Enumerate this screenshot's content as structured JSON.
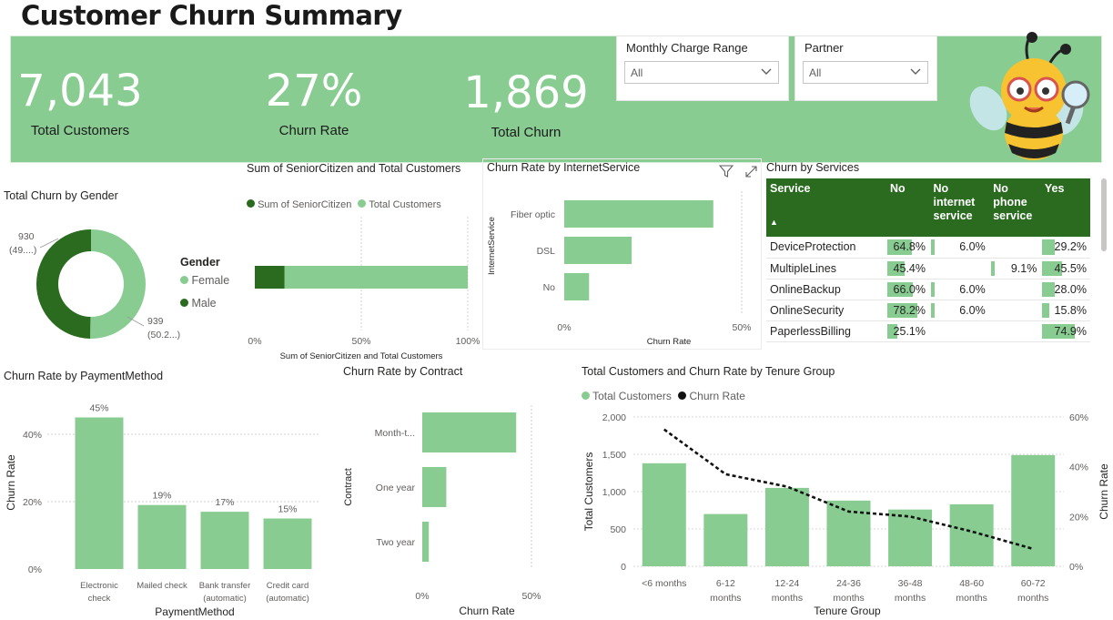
{
  "page": {
    "title": "Customer Churn Summary"
  },
  "kpis": [
    {
      "value": "7,043",
      "label": "Total Customers"
    },
    {
      "value": "27%",
      "label": "Churn Rate"
    },
    {
      "value": "1,869",
      "label": "Total Churn"
    }
  ],
  "slicers": {
    "monthly_charge": {
      "title": "Monthly Charge Range",
      "value": "All"
    },
    "partner": {
      "title": "Partner",
      "value": "All"
    }
  },
  "colors": {
    "light_green": "#88cc92",
    "dark_green": "#2a6b1f",
    "banner": "#88cc92"
  },
  "gender_chart": {
    "title": "Total Churn by Gender",
    "legend_title": "Gender",
    "legend": [
      "Female",
      "Male"
    ],
    "label_male": [
      "930",
      "(49....)"
    ],
    "label_female": [
      "939",
      "(50.2...)"
    ],
    "chart_data": {
      "type": "pie",
      "categories": [
        "Female",
        "Male"
      ],
      "values": [
        939,
        930
      ]
    }
  },
  "senior_chart": {
    "title": "Sum of SeniorCitizen and Total Customers",
    "legend": [
      "Sum of SeniorCitizen",
      "Total Customers"
    ],
    "x_ticks": [
      "0%",
      "50%",
      "100%"
    ],
    "xlabel": "Sum of SeniorCitizen and Total Customers",
    "chart_data": {
      "type": "bar",
      "orientation": "horizontal-stacked-100",
      "series": [
        {
          "name": "Sum of SeniorCitizen",
          "values": [
            14
          ]
        },
        {
          "name": "Total Customers",
          "values": [
            86
          ]
        }
      ]
    }
  },
  "internet_chart": {
    "title": "Churn Rate by InternetService",
    "ylabel": "InternetService",
    "xlabel": "Churn Rate",
    "x_ticks": [
      "0%",
      "50%"
    ],
    "chart_data": {
      "type": "bar",
      "orientation": "horizontal",
      "categories": [
        "Fiber optic",
        "DSL",
        "No"
      ],
      "values": [
        42,
        19,
        7
      ],
      "xlim": [
        0,
        50
      ]
    }
  },
  "services_table": {
    "title": "Churn by Services",
    "headers": [
      "Service",
      "No",
      "No internet service",
      "No phone service",
      "Yes"
    ],
    "rows": [
      {
        "service": "DeviceProtection",
        "no": "64.8%",
        "no_internet": "6.0%",
        "no_phone": "",
        "yes": "29.2%",
        "bars": [
          64.8,
          6.0,
          0,
          29.2
        ]
      },
      {
        "service": "MultipleLines",
        "no": "45.4%",
        "no_internet": "",
        "no_phone": "9.1%",
        "yes": "45.5%",
        "bars": [
          45.4,
          0,
          9.1,
          45.5
        ]
      },
      {
        "service": "OnlineBackup",
        "no": "66.0%",
        "no_internet": "6.0%",
        "no_phone": "",
        "yes": "28.0%",
        "bars": [
          66.0,
          6.0,
          0,
          28.0
        ]
      },
      {
        "service": "OnlineSecurity",
        "no": "78.2%",
        "no_internet": "6.0%",
        "no_phone": "",
        "yes": "15.8%",
        "bars": [
          78.2,
          6.0,
          0,
          15.8
        ]
      },
      {
        "service": "PaperlessBilling",
        "no": "25.1%",
        "no_internet": "",
        "no_phone": "",
        "yes": "74.9%",
        "bars": [
          25.1,
          0,
          0,
          74.9
        ]
      }
    ]
  },
  "payment_chart": {
    "title": "Churn Rate by PaymentMethod",
    "ylabel": "Churn Rate",
    "xlabel": "PaymentMethod",
    "y_ticks": [
      "40%",
      "20%",
      "0%"
    ],
    "data_labels": [
      "45%",
      "19%",
      "17%",
      "15%"
    ],
    "cat_lines": [
      [
        "Electronic",
        "check"
      ],
      [
        "Mailed check",
        ""
      ],
      [
        "Bank transfer",
        "(automatic)"
      ],
      [
        "Credit card",
        "(automatic)"
      ]
    ],
    "chart_data": {
      "type": "bar",
      "categories": [
        "Electronic check",
        "Mailed check",
        "Bank transfer (automatic)",
        "Credit card (automatic)"
      ],
      "values": [
        45,
        19,
        17,
        15
      ],
      "ylim": [
        0,
        50
      ]
    }
  },
  "contract_chart": {
    "title": "Churn Rate by Contract",
    "ylabel": "Contract",
    "xlabel": "Churn Rate",
    "x_ticks": [
      "0%",
      "50%"
    ],
    "cat_labels": [
      "Month-t...",
      "One year",
      "Two year"
    ],
    "chart_data": {
      "type": "bar",
      "orientation": "horizontal",
      "categories": [
        "Month-to-month",
        "One year",
        "Two year"
      ],
      "values": [
        43,
        11,
        3
      ],
      "xlim": [
        0,
        50
      ]
    }
  },
  "tenure_chart": {
    "title": "Total Customers and Churn Rate by Tenure Group",
    "legend": [
      "Total Customers",
      "Churn Rate"
    ],
    "ylabel_left": "Total Customers",
    "ylabel_right": "Churn Rate",
    "xlabel": "Tenure Group",
    "y_ticks_left": [
      "2,000",
      "1,500",
      "1,000",
      "500",
      "0"
    ],
    "y_ticks_right": [
      "60%",
      "40%",
      "20%",
      "0%"
    ],
    "cat_lines": [
      [
        "<6 months",
        ""
      ],
      [
        "6-12",
        "months"
      ],
      [
        "12-24",
        "months"
      ],
      [
        "24-36",
        "months"
      ],
      [
        "36-48",
        "months"
      ],
      [
        "48-60",
        "months"
      ],
      [
        "60-72",
        "months"
      ]
    ],
    "chart_data": {
      "type": "bar",
      "categories": [
        "<6 months",
        "6-12 months",
        "12-24 months",
        "24-36 months",
        "36-48 months",
        "48-60 months",
        "60-72 months"
      ],
      "series": [
        {
          "name": "Total Customers",
          "type": "bar",
          "values": [
            1380,
            700,
            1050,
            880,
            760,
            830,
            1490
          ]
        },
        {
          "name": "Churn Rate",
          "type": "line",
          "values": [
            55,
            37,
            32,
            22,
            20,
            14,
            7
          ]
        }
      ],
      "ylim": [
        0,
        2000
      ],
      "y2lim": [
        0,
        60
      ]
    }
  }
}
